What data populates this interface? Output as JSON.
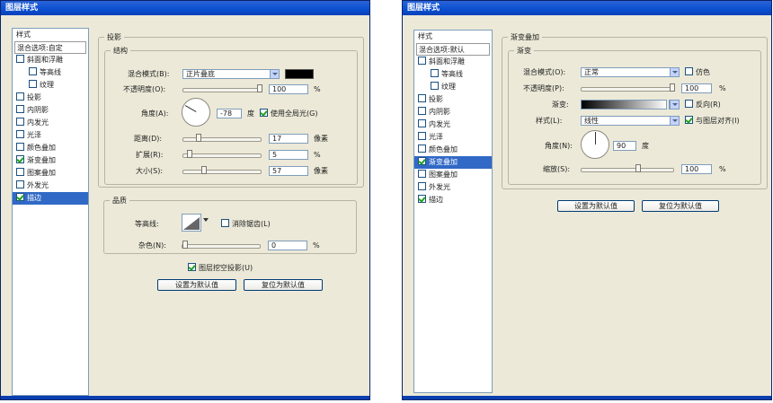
{
  "left": {
    "title": "图层样式",
    "list_items": [
      {
        "label": "样式",
        "type": "plain"
      },
      {
        "label": "混合选项:自定",
        "type": "header"
      },
      {
        "label": "斜面和浮雕",
        "type": "check",
        "checked": false
      },
      {
        "label": "等高线",
        "type": "sub",
        "checked": false
      },
      {
        "label": "纹理",
        "type": "sub",
        "checked": false
      },
      {
        "label": "投影",
        "type": "check",
        "checked": false
      },
      {
        "label": "内阴影",
        "type": "check",
        "checked": false
      },
      {
        "label": "内发光",
        "type": "check",
        "checked": false
      },
      {
        "label": "光泽",
        "type": "check",
        "checked": false
      },
      {
        "label": "颜色叠加",
        "type": "check",
        "checked": false
      },
      {
        "label": "渐变叠加",
        "type": "check",
        "checked": true
      },
      {
        "label": "图案叠加",
        "type": "check",
        "checked": false
      },
      {
        "label": "外发光",
        "type": "check",
        "checked": false
      },
      {
        "label": "描边",
        "type": "check",
        "checked": true,
        "selected": true
      }
    ],
    "outer_group": "投影",
    "structure_group": "结构",
    "blend_mode_label": "混合模式(B):",
    "blend_mode_value": "正片叠底",
    "opacity_label": "不透明度(O):",
    "opacity_value": "100",
    "opacity_percent": 1.0,
    "angle_label": "角度(A):",
    "angle_value": "-78",
    "angle_unit": "度",
    "global_light_label": "使用全局光(G)",
    "global_light_checked": true,
    "distance_label": "距离(D):",
    "distance_value": "17",
    "distance_unit": "像素",
    "spread_label": "扩展(R):",
    "spread_value": "5",
    "spread_unit": "%",
    "size_label": "大小(S):",
    "size_value": "57",
    "size_unit": "像素",
    "quality_group": "品质",
    "contour_label": "等高线:",
    "antialias_label": "消除锯齿(L)",
    "antialias_checked": false,
    "noise_label": "杂色(N):",
    "noise_value": "0",
    "percent_sign": "%",
    "knockout_label": "图层挖空投影(U)",
    "knockout_checked": true,
    "btn_default": "设置为默认值",
    "btn_reset": "复位为默认值"
  },
  "right": {
    "title": "图层样式",
    "list_items": [
      {
        "label": "样式",
        "type": "plain"
      },
      {
        "label": "混合选项:默认",
        "type": "header"
      },
      {
        "label": "斜面和浮雕",
        "type": "check",
        "checked": false
      },
      {
        "label": "等高线",
        "type": "sub",
        "checked": false
      },
      {
        "label": "纹理",
        "type": "sub",
        "checked": false
      },
      {
        "label": "投影",
        "type": "check",
        "checked": false
      },
      {
        "label": "内阴影",
        "type": "check",
        "checked": false
      },
      {
        "label": "内发光",
        "type": "check",
        "checked": false
      },
      {
        "label": "光泽",
        "type": "check",
        "checked": false
      },
      {
        "label": "颜色叠加",
        "type": "check",
        "checked": false
      },
      {
        "label": "渐变叠加",
        "type": "check",
        "checked": true,
        "selected": true
      },
      {
        "label": "图案叠加",
        "type": "check",
        "checked": false
      },
      {
        "label": "外发光",
        "type": "check",
        "checked": false
      },
      {
        "label": "描边",
        "type": "check",
        "checked": true
      }
    ],
    "outer_group": "渐变叠加",
    "inner_group": "渐变",
    "blend_mode_label": "混合模式(O):",
    "blend_mode_value": "正常",
    "dither_label": "仿色",
    "dither_checked": false,
    "opacity_label": "不透明度(P):",
    "opacity_value": "100",
    "opacity_percent": 1.0,
    "gradient_label": "渐变:",
    "reverse_label": "反向(R)",
    "reverse_checked": false,
    "style_label": "样式(L):",
    "style_value": "线性",
    "align_label": "与图层对齐(I)",
    "align_checked": true,
    "angle_label": "角度(N):",
    "angle_value": "90",
    "angle_unit": "度",
    "scale_label": "缩放(S):",
    "scale_value": "100",
    "scale_percent": 0.6,
    "percent_sign": "%",
    "btn_default": "设置为默认值",
    "btn_reset": "复位为默认值"
  }
}
